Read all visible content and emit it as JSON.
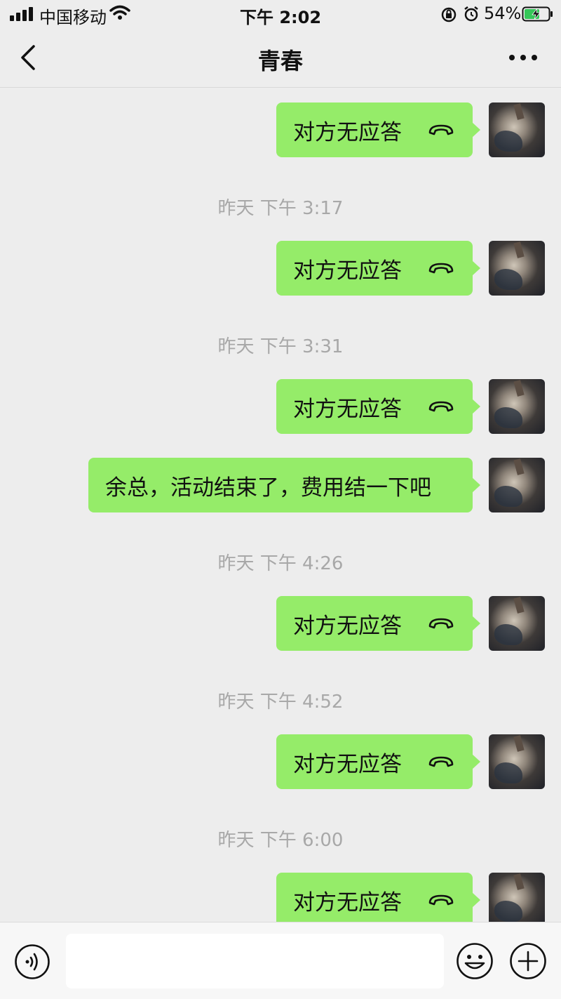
{
  "status_bar": {
    "carrier": "中国移动",
    "time": "下午 2:02",
    "battery": "54%"
  },
  "nav": {
    "title": "青春"
  },
  "messages": [
    {
      "type": "call",
      "text": "对方无应答",
      "icon": "phone-hangup-icon"
    },
    {
      "type": "time",
      "text": "昨天 下午 3:17"
    },
    {
      "type": "call",
      "text": "对方无应答",
      "icon": "phone-hangup-icon"
    },
    {
      "type": "time",
      "text": "昨天 下午 3:31"
    },
    {
      "type": "call",
      "text": "对方无应答",
      "icon": "phone-hangup-icon"
    },
    {
      "type": "text",
      "text": "余总，活动结束了，费用结一下吧"
    },
    {
      "type": "time",
      "text": "昨天 下午 4:26"
    },
    {
      "type": "call",
      "text": "对方无应答",
      "icon": "phone-hangup-icon"
    },
    {
      "type": "time",
      "text": "昨天 下午 4:52"
    },
    {
      "type": "call",
      "text": "对方无应答",
      "icon": "phone-hangup-icon"
    },
    {
      "type": "time",
      "text": "昨天 下午 6:00"
    },
    {
      "type": "call",
      "text": "对方无应答",
      "icon": "phone-hangup-icon"
    }
  ],
  "input_bar": {
    "value": "",
    "icons": [
      "voice-icon",
      "emoji-icon",
      "plus-icon"
    ]
  },
  "colors": {
    "bubble": "#95ec69",
    "background": "#ededed",
    "timestamp": "#a8a8a8"
  }
}
